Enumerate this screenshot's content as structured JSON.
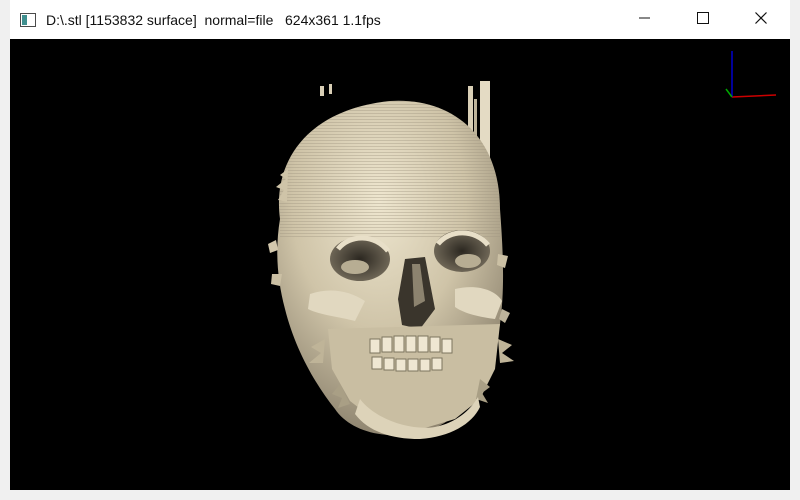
{
  "window": {
    "title": "D:\\.stl [1153832 surface]  normal=file   624x361 1.1fps",
    "app_icon": "viewer-app-icon",
    "controls": {
      "minimize_icon": "minimize-icon",
      "maximize_icon": "maximize-icon",
      "close_icon": "close-icon"
    }
  },
  "viewport": {
    "background": "#000000",
    "model_color": "#d9cfb6",
    "axes": {
      "x_color": "#cc0000",
      "y_color": "#00aa00",
      "z_color": "#0000cc"
    }
  }
}
